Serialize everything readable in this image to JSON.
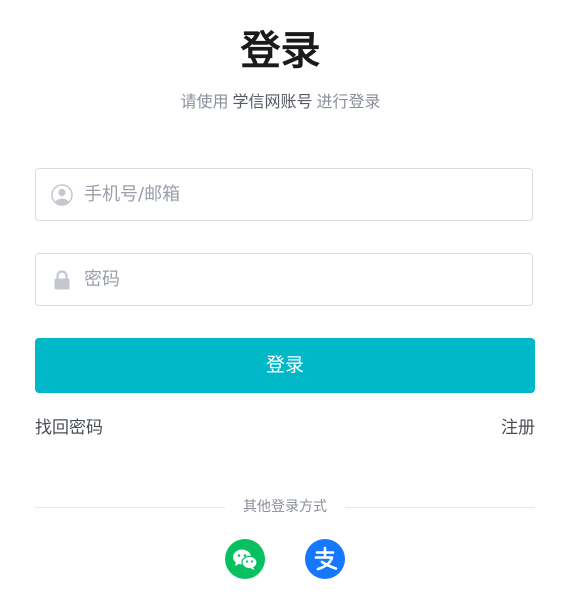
{
  "header": {
    "title": "登录",
    "subtitle_prefix": "请使用",
    "subtitle_brand": "学信网账号",
    "subtitle_suffix": "进行登录"
  },
  "form": {
    "username": {
      "placeholder": "手机号/邮箱",
      "value": "",
      "icon": "user-circle-icon"
    },
    "password": {
      "placeholder": "密码",
      "value": "",
      "icon": "lock-icon"
    },
    "submit_label": "登录"
  },
  "links": {
    "forgot_password": "找回密码",
    "register": "注册"
  },
  "social": {
    "divider_label": "其他登录方式",
    "providers": [
      {
        "name": "wechat",
        "icon": "wechat-icon",
        "color": "#07c160"
      },
      {
        "name": "alipay",
        "icon": "alipay-icon",
        "color": "#1677ff"
      }
    ]
  },
  "colors": {
    "accent": "#00b8c8",
    "border": "#d9dce1"
  }
}
